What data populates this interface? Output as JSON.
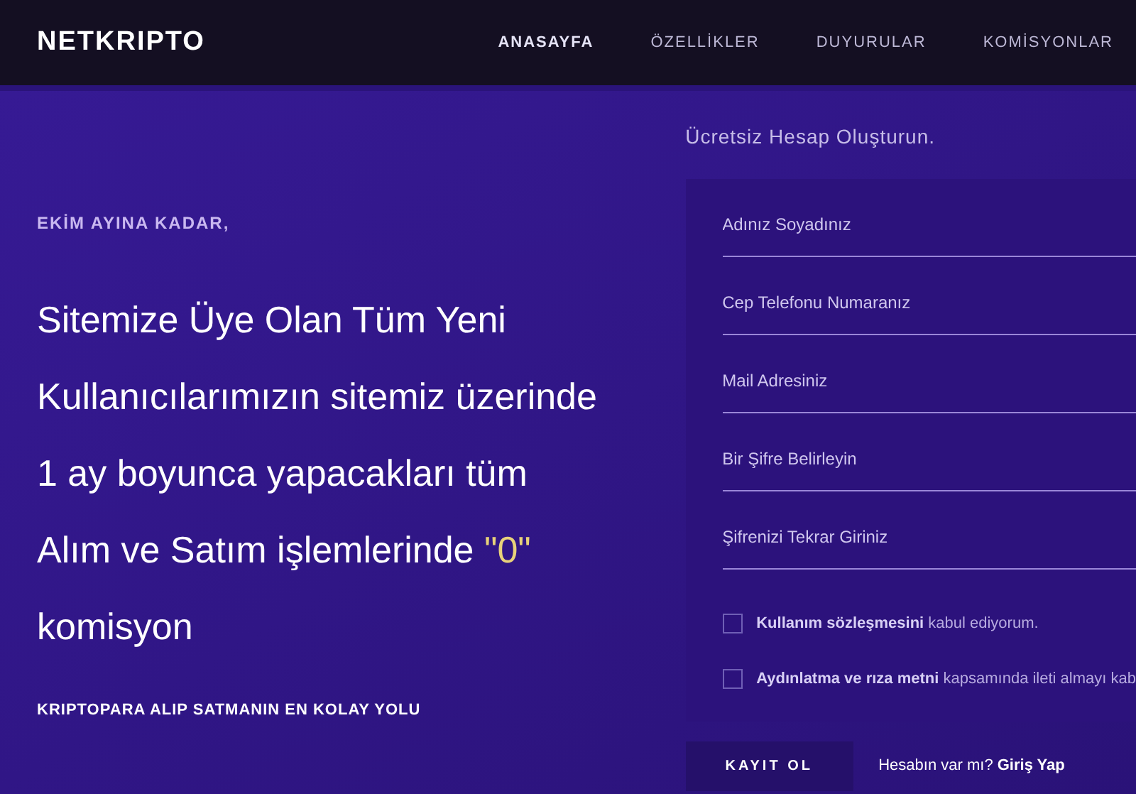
{
  "header": {
    "logo": "NETKRIPTO",
    "nav": [
      {
        "label": "ANASAYFA",
        "selected": true
      },
      {
        "label": "ÖZELLİKLER",
        "selected": false
      },
      {
        "label": "DUYURULAR",
        "selected": false
      },
      {
        "label": "KOMİSYONLAR",
        "selected": false
      }
    ]
  },
  "hero": {
    "eyebrow": "EKİM AYINA KADAR,",
    "headline": [
      {
        "text": "Sitemize Üye Olan Tüm Yeni"
      },
      {
        "text": "Kullanıcılarımızın sitemiz üzerinde"
      },
      {
        "text": "1 ay boyunca yapacakları tüm"
      },
      {
        "text": "Alım ve Satım işlemlerinde ",
        "highlight": "\"0\""
      },
      {
        "text": "komisyon"
      }
    ],
    "tagline": "KRIPTOPARA ALIP SATMANIN EN KOLAY YOLU"
  },
  "form": {
    "title": "Ücretsiz Hesap Oluşturun.",
    "fields": [
      {
        "placeholder": "Adınız Soyadınız"
      },
      {
        "placeholder": "Cep Telefonu Numaranız"
      },
      {
        "placeholder": "Mail Adresiniz"
      },
      {
        "placeholder": "Bir Şifre Belirleyin"
      },
      {
        "placeholder": "Şifrenizi Tekrar Giriniz"
      }
    ],
    "checkboxes": [
      {
        "label": "**Kullanım sözleşmesini** kabul ediyorum.",
        "checked": false
      },
      {
        "label": "**Aydınlatma ve rıza metni** kapsamında ileti almayı kab",
        "checked": false
      }
    ],
    "submit": "KAYIT OL",
    "login_prompt": "Hesabın var mı? **Giriş Yap**"
  }
}
